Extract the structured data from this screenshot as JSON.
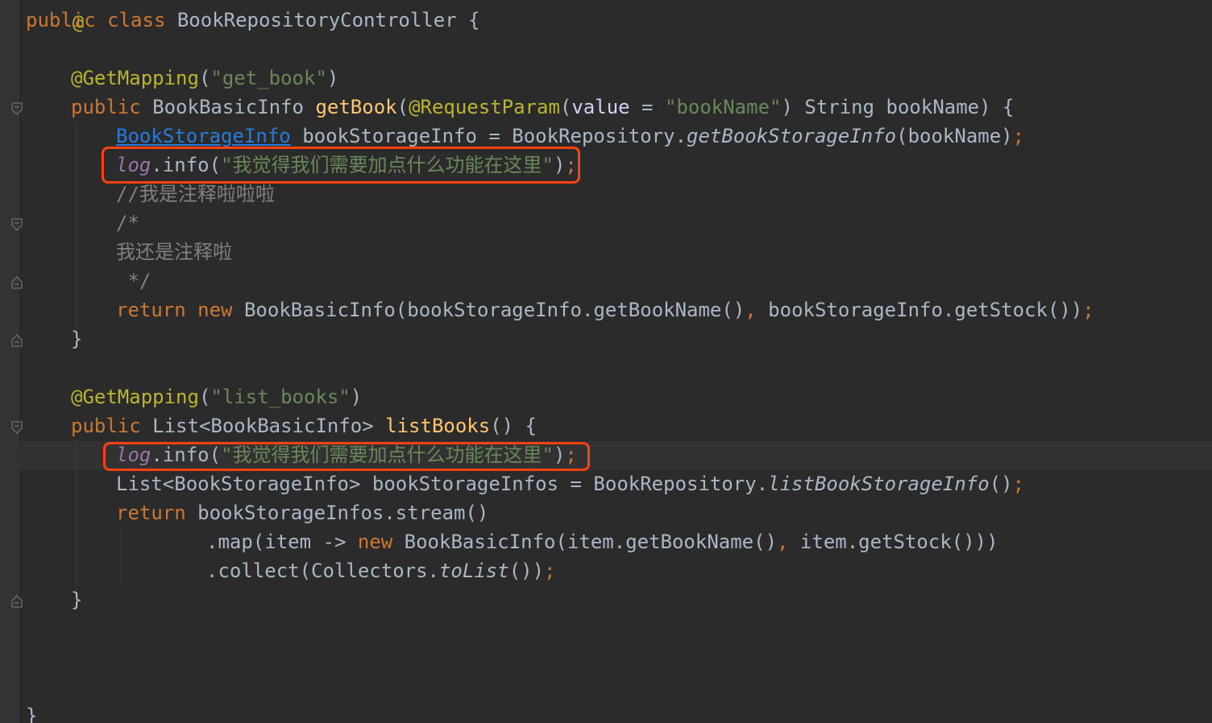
{
  "editor": {
    "theme": "darcula",
    "colors": {
      "background": "#2b2b2b",
      "keyword": "#cc7832",
      "annotation": "#bbb529",
      "string": "#6a8759",
      "method": "#ffc66d",
      "field": "#9876aa",
      "comment": "#808080",
      "highlight_box": "#ff4111"
    }
  },
  "code": {
    "top_fragment": "@",
    "line1": {
      "kw_public": "public",
      "kw_class": "class",
      "class_name": "BookRepositoryController",
      "brace": "{"
    },
    "line3": {
      "annotation": "@GetMapping",
      "open": "(",
      "str": "\"get_book\"",
      "close": ")"
    },
    "line4": {
      "kw_public": "public",
      "ret_type": "BookBasicInfo",
      "method": "getBook",
      "open": "(",
      "annotation": "@RequestParam",
      "ann_open": "(",
      "param_key": "value",
      "eq": " = ",
      "param_val": "\"bookName\"",
      "ann_close": ")",
      "rest": " String bookName) {"
    },
    "line5": {
      "type_link": "BookStorageInfo",
      "mid": " bookStorageInfo = BookRepository.",
      "static_call": "getBookStorageInfo",
      "args": "(bookName)",
      "semi": ";"
    },
    "line6": {
      "field": "log",
      "dot_call": ".info(",
      "str": "\"我觉得我们需要加点什么功能在这里\"",
      "close": ")",
      "semi": ";"
    },
    "line7": {
      "comment": "//我是注释啦啦啦"
    },
    "line8": {
      "comment": "/*"
    },
    "line9": {
      "comment": "我还是注释啦"
    },
    "line10": {
      "comment": " */"
    },
    "line11": {
      "kw_return": "return",
      "kw_new": "new",
      "call": " BookBasicInfo(bookStorageInfo.getBookName()",
      "comma": ",",
      "call2": " bookStorageInfo.getStock())",
      "semi": ";"
    },
    "line12": {
      "brace": "}"
    },
    "line14": {
      "annotation": "@GetMapping",
      "open": "(",
      "str": "\"list_books\"",
      "close": ")"
    },
    "line15": {
      "kw_public": "public",
      "ret_type": "List<BookBasicInfo>",
      "method": "listBooks",
      "rest": "() {"
    },
    "line16": {
      "field": "log",
      "dot_call": ".info(",
      "str": "\"我觉得我们需要加点什么功能在这里\"",
      "close": ")",
      "semi": ";"
    },
    "line17": {
      "decl": "List<BookStorageInfo> bookStorageInfos = BookRepository.",
      "static_call": "listBookStorageInfo",
      "args": "()",
      "semi": ";"
    },
    "line18": {
      "kw_return": "return",
      "rest": " bookStorageInfos.stream()"
    },
    "line19": {
      "pre": ".map(item -> ",
      "kw_new": "new",
      "call": " BookBasicInfo(item.getBookName()",
      "comma": ",",
      "call2": " item.getStock()))"
    },
    "line20": {
      "pre": ".collect(Collectors.",
      "static_call": "toList",
      "args": "())",
      "semi": ";"
    },
    "line21": {
      "brace": "}"
    },
    "line24": {
      "brace": "}"
    }
  }
}
